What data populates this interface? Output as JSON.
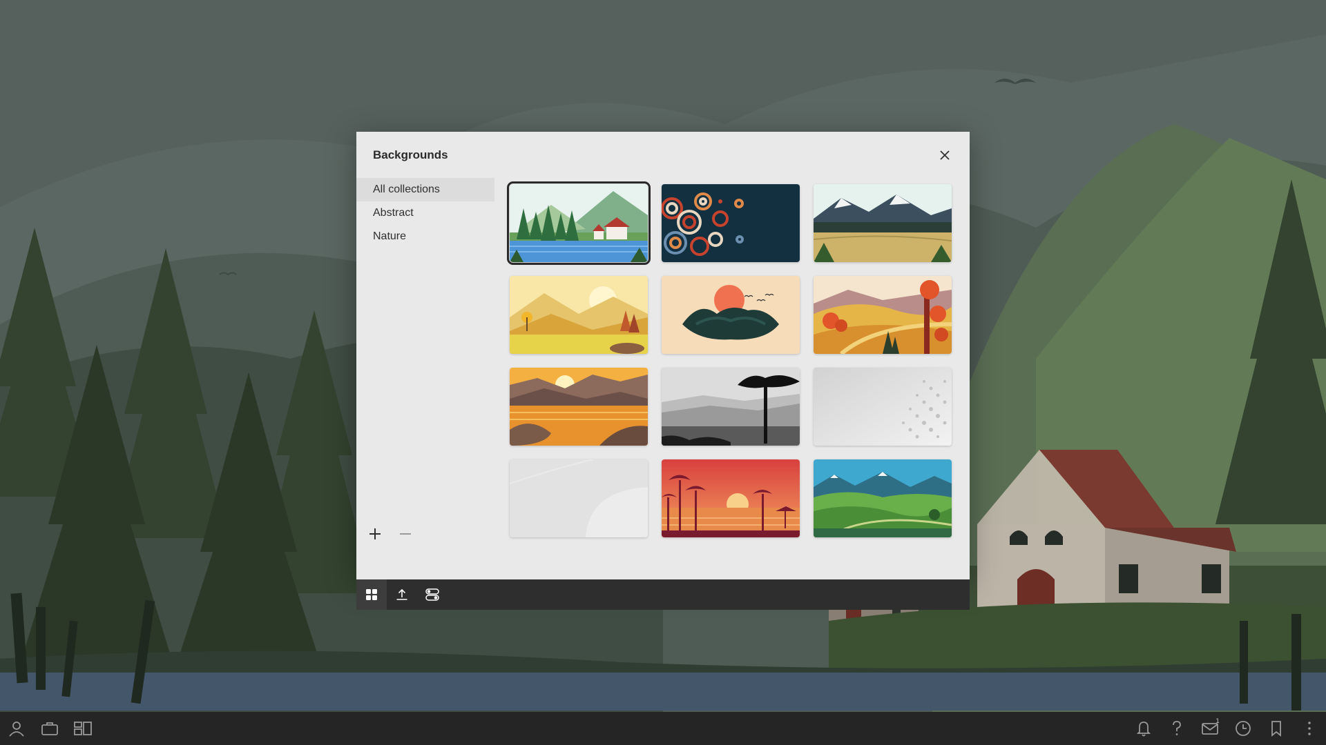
{
  "dialog": {
    "title": "Backgrounds",
    "sidebar": [
      {
        "label": "All collections",
        "active": true
      },
      {
        "label": "Abstract",
        "active": false
      },
      {
        "label": "Nature",
        "active": false
      }
    ],
    "thumbnails": [
      {
        "name": "forest-lake-house",
        "selected": true
      },
      {
        "name": "abstract-circles",
        "selected": false
      },
      {
        "name": "mountain-meadow",
        "selected": false
      },
      {
        "name": "yellow-hills-sun",
        "selected": false
      },
      {
        "name": "dark-island-sunset",
        "selected": false
      },
      {
        "name": "autumn-trees",
        "selected": false
      },
      {
        "name": "golden-river-sunset",
        "selected": false
      },
      {
        "name": "grayscale-savanna",
        "selected": false
      },
      {
        "name": "gray-dots-gradient",
        "selected": false
      },
      {
        "name": "light-gray-arc",
        "selected": false
      },
      {
        "name": "tropical-sunset-palms",
        "selected": false
      },
      {
        "name": "green-valley-mountains",
        "selected": false
      }
    ]
  },
  "taskbar": {
    "mail_badge": "1"
  },
  "colors": {
    "dialog_bg": "#e9e9e9",
    "footer_bg": "#2e2e2e",
    "taskbar_bg": "#252525",
    "selected_outline": "#2a2a2a"
  }
}
